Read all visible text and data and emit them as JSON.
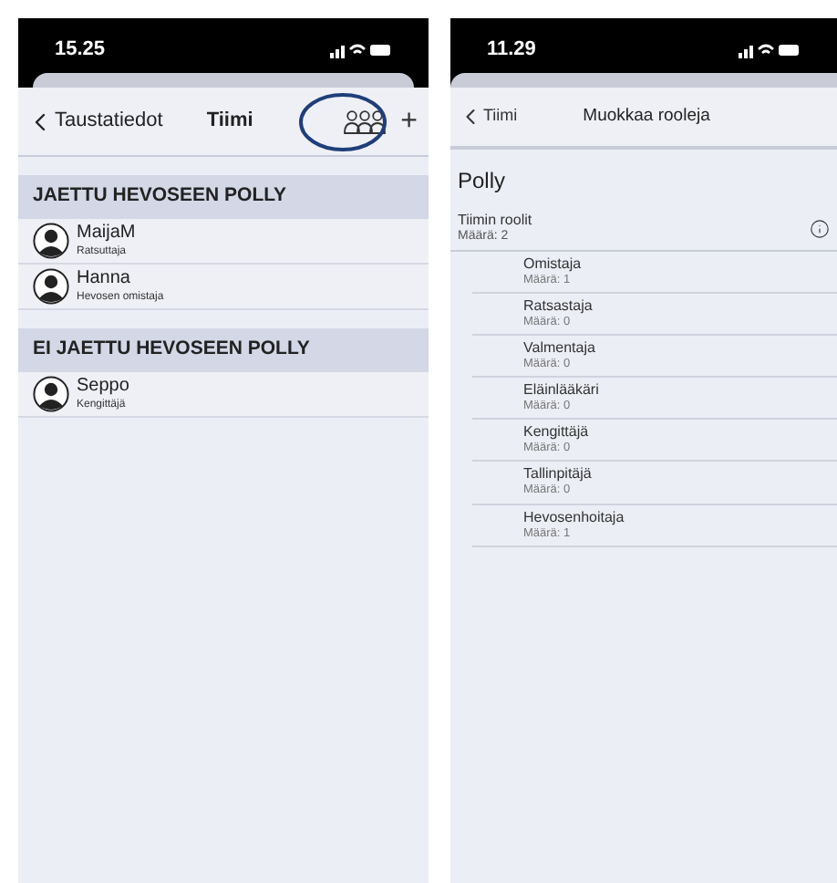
{
  "left_screen": {
    "status_bar": {
      "time": "15.25"
    },
    "nav": {
      "back": "Taustatiedot",
      "title": "Tiimi",
      "add": "+"
    },
    "sections": [
      {
        "title": "JAETTU HEVOSEEN POLLY",
        "members": [
          {
            "name": "MaijaM",
            "role": "Ratsuttaja"
          },
          {
            "name": "Hanna",
            "role": "Hevosen omistaja"
          }
        ]
      },
      {
        "title": "EI JAETTU HEVOSEEN POLLY",
        "members": [
          {
            "name": "Seppo",
            "role": "Kengittäjä"
          }
        ]
      }
    ]
  },
  "right_screen": {
    "status_bar": {
      "time": "11.29"
    },
    "nav": {
      "back": "Tiimi",
      "title": "Muokkaa rooleja"
    },
    "horse": "Polly",
    "team_roles": {
      "title": "Tiimin roolit",
      "count": "Määrä: 2"
    },
    "roles": [
      {
        "name": "Omistaja",
        "count": "Määrä: 1"
      },
      {
        "name": "Ratsastaja",
        "count": "Määrä: 0"
      },
      {
        "name": "Valmentaja",
        "count": "Määrä: 0"
      },
      {
        "name": "Eläinlääkäri",
        "count": "Määrä: 0"
      },
      {
        "name": "Kengittäjä",
        "count": "Määrä: 0"
      },
      {
        "name": "Tallinpitäjä",
        "count": "Määrä: 0"
      },
      {
        "name": "Hevosenhoitaja",
        "count": "Määrä: 1"
      }
    ]
  }
}
